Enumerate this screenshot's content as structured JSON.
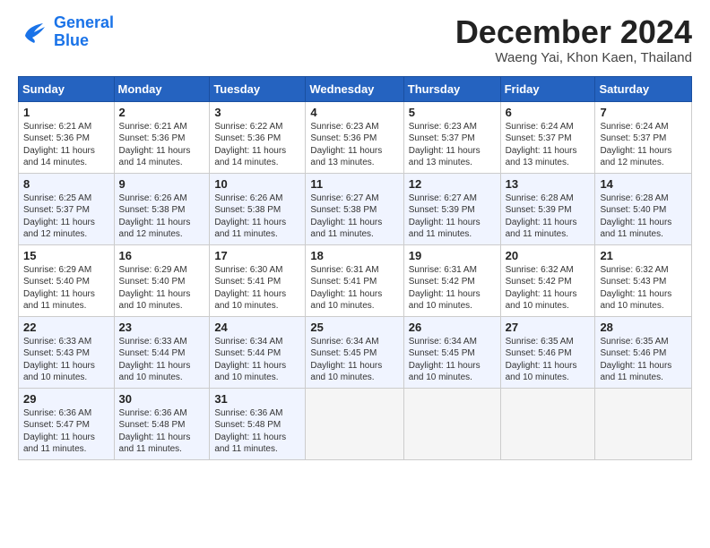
{
  "header": {
    "logo_line1": "General",
    "logo_line2": "Blue",
    "month_title": "December 2024",
    "location": "Waeng Yai, Khon Kaen, Thailand"
  },
  "days_of_week": [
    "Sunday",
    "Monday",
    "Tuesday",
    "Wednesday",
    "Thursday",
    "Friday",
    "Saturday"
  ],
  "weeks": [
    [
      {
        "day": 1,
        "sunrise": "6:21 AM",
        "sunset": "5:36 PM",
        "daylight": "11 hours and 14 minutes."
      },
      {
        "day": 2,
        "sunrise": "6:21 AM",
        "sunset": "5:36 PM",
        "daylight": "11 hours and 14 minutes."
      },
      {
        "day": 3,
        "sunrise": "6:22 AM",
        "sunset": "5:36 PM",
        "daylight": "11 hours and 14 minutes."
      },
      {
        "day": 4,
        "sunrise": "6:23 AM",
        "sunset": "5:36 PM",
        "daylight": "11 hours and 13 minutes."
      },
      {
        "day": 5,
        "sunrise": "6:23 AM",
        "sunset": "5:37 PM",
        "daylight": "11 hours and 13 minutes."
      },
      {
        "day": 6,
        "sunrise": "6:24 AM",
        "sunset": "5:37 PM",
        "daylight": "11 hours and 13 minutes."
      },
      {
        "day": 7,
        "sunrise": "6:24 AM",
        "sunset": "5:37 PM",
        "daylight": "11 hours and 12 minutes."
      }
    ],
    [
      {
        "day": 8,
        "sunrise": "6:25 AM",
        "sunset": "5:37 PM",
        "daylight": "11 hours and 12 minutes."
      },
      {
        "day": 9,
        "sunrise": "6:26 AM",
        "sunset": "5:38 PM",
        "daylight": "11 hours and 12 minutes."
      },
      {
        "day": 10,
        "sunrise": "6:26 AM",
        "sunset": "5:38 PM",
        "daylight": "11 hours and 11 minutes."
      },
      {
        "day": 11,
        "sunrise": "6:27 AM",
        "sunset": "5:38 PM",
        "daylight": "11 hours and 11 minutes."
      },
      {
        "day": 12,
        "sunrise": "6:27 AM",
        "sunset": "5:39 PM",
        "daylight": "11 hours and 11 minutes."
      },
      {
        "day": 13,
        "sunrise": "6:28 AM",
        "sunset": "5:39 PM",
        "daylight": "11 hours and 11 minutes."
      },
      {
        "day": 14,
        "sunrise": "6:28 AM",
        "sunset": "5:40 PM",
        "daylight": "11 hours and 11 minutes."
      }
    ],
    [
      {
        "day": 15,
        "sunrise": "6:29 AM",
        "sunset": "5:40 PM",
        "daylight": "11 hours and 11 minutes."
      },
      {
        "day": 16,
        "sunrise": "6:29 AM",
        "sunset": "5:40 PM",
        "daylight": "11 hours and 10 minutes."
      },
      {
        "day": 17,
        "sunrise": "6:30 AM",
        "sunset": "5:41 PM",
        "daylight": "11 hours and 10 minutes."
      },
      {
        "day": 18,
        "sunrise": "6:31 AM",
        "sunset": "5:41 PM",
        "daylight": "11 hours and 10 minutes."
      },
      {
        "day": 19,
        "sunrise": "6:31 AM",
        "sunset": "5:42 PM",
        "daylight": "11 hours and 10 minutes."
      },
      {
        "day": 20,
        "sunrise": "6:32 AM",
        "sunset": "5:42 PM",
        "daylight": "11 hours and 10 minutes."
      },
      {
        "day": 21,
        "sunrise": "6:32 AM",
        "sunset": "5:43 PM",
        "daylight": "11 hours and 10 minutes."
      }
    ],
    [
      {
        "day": 22,
        "sunrise": "6:33 AM",
        "sunset": "5:43 PM",
        "daylight": "11 hours and 10 minutes."
      },
      {
        "day": 23,
        "sunrise": "6:33 AM",
        "sunset": "5:44 PM",
        "daylight": "11 hours and 10 minutes."
      },
      {
        "day": 24,
        "sunrise": "6:34 AM",
        "sunset": "5:44 PM",
        "daylight": "11 hours and 10 minutes."
      },
      {
        "day": 25,
        "sunrise": "6:34 AM",
        "sunset": "5:45 PM",
        "daylight": "11 hours and 10 minutes."
      },
      {
        "day": 26,
        "sunrise": "6:34 AM",
        "sunset": "5:45 PM",
        "daylight": "11 hours and 10 minutes."
      },
      {
        "day": 27,
        "sunrise": "6:35 AM",
        "sunset": "5:46 PM",
        "daylight": "11 hours and 10 minutes."
      },
      {
        "day": 28,
        "sunrise": "6:35 AM",
        "sunset": "5:46 PM",
        "daylight": "11 hours and 11 minutes."
      }
    ],
    [
      {
        "day": 29,
        "sunrise": "6:36 AM",
        "sunset": "5:47 PM",
        "daylight": "11 hours and 11 minutes."
      },
      {
        "day": 30,
        "sunrise": "6:36 AM",
        "sunset": "5:48 PM",
        "daylight": "11 hours and 11 minutes."
      },
      {
        "day": 31,
        "sunrise": "6:36 AM",
        "sunset": "5:48 PM",
        "daylight": "11 hours and 11 minutes."
      },
      null,
      null,
      null,
      null
    ]
  ]
}
